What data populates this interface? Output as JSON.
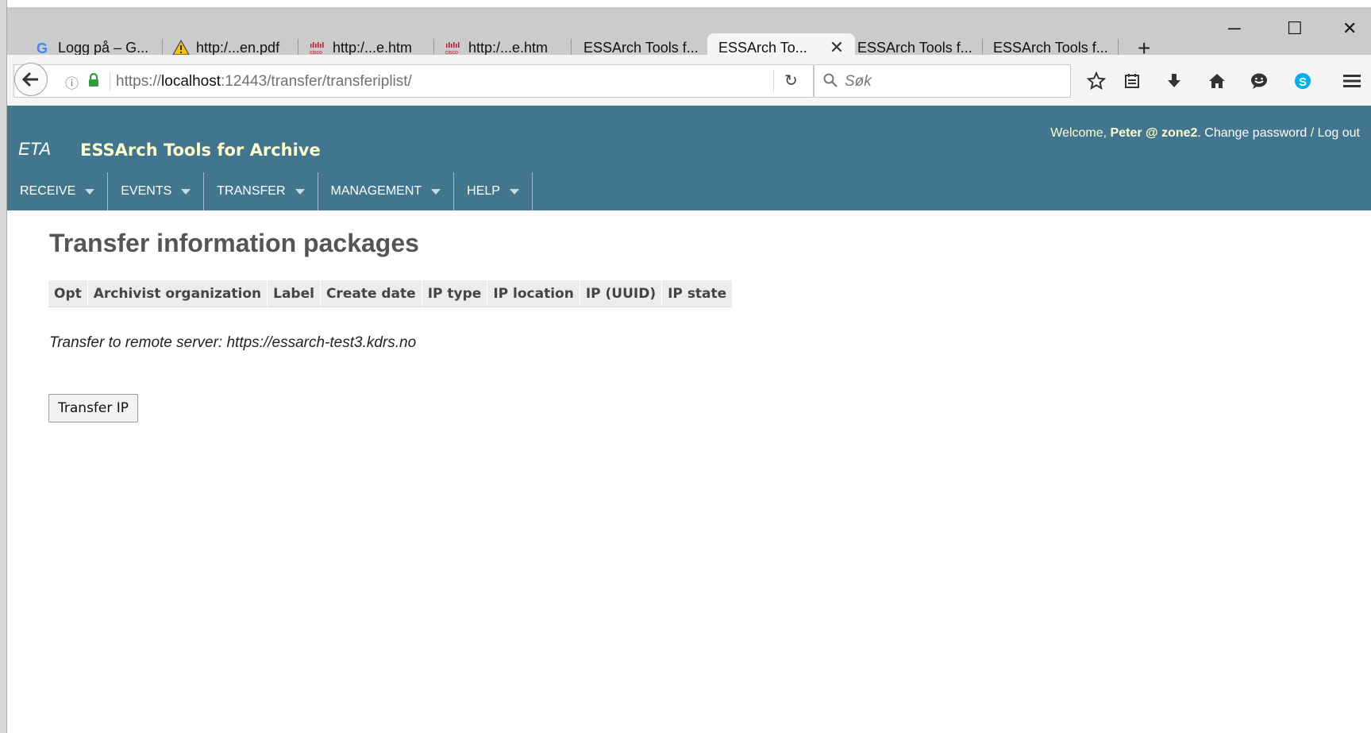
{
  "browser": {
    "tabs": [
      {
        "label": "Logg på – G...",
        "icon": "google-icon"
      },
      {
        "label": "http:/...en.pdf",
        "icon": "warning-icon"
      },
      {
        "label": "http:/...e.htm",
        "icon": "cisco-icon"
      },
      {
        "label": "http:/...e.htm",
        "icon": "cisco-icon"
      },
      {
        "label": "ESSArch Tools f...",
        "icon": null
      },
      {
        "label": "ESSArch To...",
        "icon": null,
        "active": true
      },
      {
        "label": "ESSArch Tools f...",
        "icon": null
      },
      {
        "label": "ESSArch Tools f...",
        "icon": null
      }
    ],
    "new_tab_label": "+",
    "url_prefix": "https://",
    "url_host": "localhost",
    "url_rest": ":12443/transfer/transferiplist/",
    "search_placeholder": "Søk"
  },
  "app": {
    "brand_short": "ETA",
    "brand_long": "ESSArch Tools for Archive",
    "user": {
      "welcome": "Welcome, ",
      "name": "Peter @ zone2",
      "change_password": ". Change password",
      "separator": " / ",
      "logout": "Log out"
    },
    "menu": [
      {
        "label": "RECEIVE"
      },
      {
        "label": "EVENTS"
      },
      {
        "label": "TRANSFER"
      },
      {
        "label": "MANAGEMENT"
      },
      {
        "label": "HELP"
      }
    ]
  },
  "page": {
    "title": "Transfer information packages",
    "table_headers": [
      "Opt",
      "Archivist organization",
      "Label",
      "Create date",
      "IP type",
      "IP location",
      "IP (UUID)",
      "IP state"
    ],
    "remote_note": "Transfer to remote server: https://essarch-test3.kdrs.no",
    "transfer_button": "Transfer IP"
  },
  "colors": {
    "header_bg": "#42768f",
    "brand_text": "#ffffcc"
  }
}
